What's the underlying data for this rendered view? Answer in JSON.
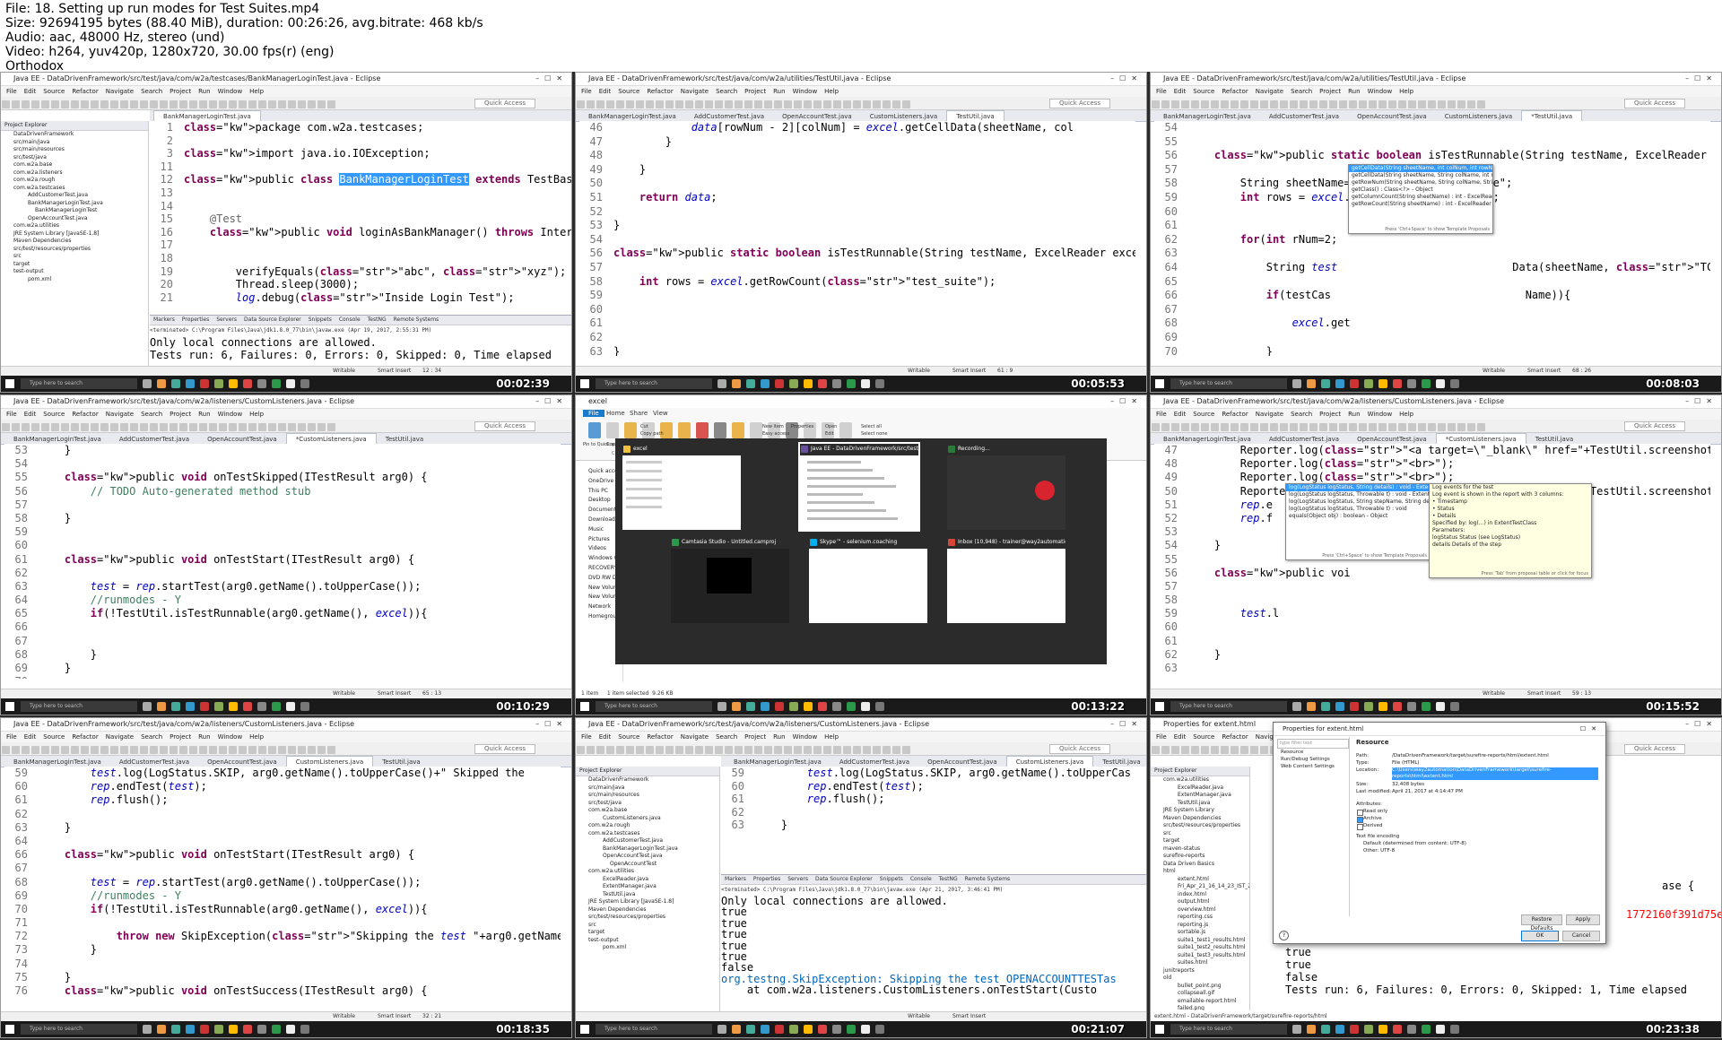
{
  "header": {
    "file": "File: 18. Setting up run modes for Test Suites.mp4",
    "size": "Size: 92694195 bytes (88.40 MiB), duration: 00:26:26, avg.bitrate: 468 kb/s",
    "audio": "Audio: aac, 48000 Hz, stereo (und)",
    "video": "Video: h264, yuv420p, 1280x720, 30.00 fps(r) (eng)",
    "watermark": "Orthodox"
  },
  "common": {
    "menu": [
      "File",
      "Edit",
      "Source",
      "Refactor",
      "Navigate",
      "Search",
      "Project",
      "Run",
      "Window",
      "Help"
    ],
    "quick_access": "Quick Access",
    "taskbar_search": "Type here to search",
    "status_writable": "Writable",
    "status_insert": "Smart Insert",
    "console_tabs": [
      "Markers",
      "Properties",
      "Servers",
      "Data Source Explorer",
      "Snippets",
      "Console",
      "TestNG",
      "Remote Systems"
    ],
    "explorer_title": "Project Explorer"
  },
  "tiles": [
    {
      "title": "Java EE - DataDrivenFramework/src/test/java/com/w2a/testcases/BankManagerLoginTest.java - Eclipse",
      "timestamp": "00:02:39",
      "tabs": [
        "BankManagerLoginTest.java"
      ],
      "explorer": [
        "DataDrivenFramework",
        "src/main/java",
        "src/main/resources",
        "src/test/java",
        "com.w2a.base",
        "com.w2a.listeners",
        "com.w2a.rough",
        "com.w2a.testcases",
        "AddCustomerTest.java",
        "BankManagerLoginTest.java",
        "BankManagerLoginTest",
        "OpenAccountTest.java",
        "com.w2a.utilities",
        "JRE System Library [JavaSE-1.8]",
        "Maven Dependencies",
        "src/test/resources/properties",
        "src",
        "target",
        "test-output",
        "pom.xml"
      ],
      "code": [
        {
          "n": "1",
          "t": "package com.w2a.testcases;"
        },
        {
          "n": "2",
          "t": ""
        },
        {
          "n": "3",
          "t": "import java.io.IOException;"
        },
        {
          "n": "11",
          "t": ""
        },
        {
          "n": "12",
          "t": "public class BankManagerLoginTest extends TestBase {"
        },
        {
          "n": "13",
          "t": ""
        },
        {
          "n": "14",
          "t": ""
        },
        {
          "n": "15",
          "t": "    @Test"
        },
        {
          "n": "16",
          "t": "    public void loginAsBankManager() throws InterruptedExc"
        },
        {
          "n": "17",
          "t": ""
        },
        {
          "n": "18",
          "t": ""
        },
        {
          "n": "19",
          "t": "        verifyEquals(\"abc\", \"xyz\");"
        },
        {
          "n": "20",
          "t": "        Thread.sleep(3000);"
        },
        {
          "n": "21",
          "t": "        log.debug(\"Inside Login Test\");"
        }
      ],
      "console_header": "<terminated> C:\\Program Files\\Java\\jdk1.8.0_77\\bin\\javaw.exe (Apr 19, 2017, 2:55:31 PM)",
      "console": [
        "Only local connections are allowed.",
        "Tests run: 6, Failures: 0, Errors: 0, Skipped: 0, Time elapsed"
      ],
      "status_pos": "12 : 34"
    },
    {
      "title": "Java EE - DataDrivenFramework/src/test/java/com/w2a/utilities/TestUtil.java - Eclipse",
      "timestamp": "00:05:53",
      "tabs": [
        "BankManagerLoginTest.java",
        "AddCustomerTest.java",
        "OpenAccountTest.java",
        "CustomListeners.java",
        "TestUtil.java"
      ],
      "code": [
        {
          "n": "46",
          "t": "            data[rowNum - 2][colNum] = excel.getCellData(sheetName, col"
        },
        {
          "n": "47",
          "t": "        }"
        },
        {
          "n": "48",
          "t": ""
        },
        {
          "n": "49",
          "t": "    }"
        },
        {
          "n": "50",
          "t": ""
        },
        {
          "n": "51",
          "t": "    return data;"
        },
        {
          "n": "52",
          "t": ""
        },
        {
          "n": "53",
          "t": "}"
        },
        {
          "n": "54",
          "t": ""
        },
        {
          "n": "56",
          "t": "public static boolean isTestRunnable(String testName, ExcelReader excel"
        },
        {
          "n": "57",
          "t": ""
        },
        {
          "n": "58",
          "t": "    int rows = excel.getRowCount(\"test_suite\");"
        },
        {
          "n": "59",
          "t": ""
        },
        {
          "n": "60",
          "t": ""
        },
        {
          "n": "61",
          "t": ""
        },
        {
          "n": "62",
          "t": ""
        },
        {
          "n": "63",
          "t": "}"
        }
      ],
      "status_pos": "61 : 9"
    },
    {
      "title": "Java EE - DataDrivenFramework/src/test/java/com/w2a/utilities/TestUtil.java - Eclipse",
      "timestamp": "00:08:03",
      "tabs": [
        "BankManagerLoginTest.java",
        "AddCustomerTest.java",
        "OpenAccountTest.java",
        "CustomListeners.java",
        "*TestUtil.java"
      ],
      "code": [
        {
          "n": "54",
          "t": ""
        },
        {
          "n": "55",
          "t": ""
        },
        {
          "n": "56",
          "t": "    public static boolean isTestRunnable(String testName, ExcelReader excel"
        },
        {
          "n": "57",
          "t": ""
        },
        {
          "n": "58",
          "t": "        String sheetName=\"test_suite\";"
        },
        {
          "n": "59",
          "t": "        int rows = excel.getRowCount(sheetName);"
        },
        {
          "n": "60",
          "t": ""
        },
        {
          "n": "61",
          "t": ""
        },
        {
          "n": "62",
          "t": "        for(int rNum=2;"
        },
        {
          "n": "63",
          "t": ""
        },
        {
          "n": "64",
          "t": "            String test                           Data(sheetName, \"TCID\", rNum);"
        },
        {
          "n": "65",
          "t": ""
        },
        {
          "n": "66",
          "t": "            if(testCas                              Name)){"
        },
        {
          "n": "67",
          "t": ""
        },
        {
          "n": "68",
          "t": "                excel.get"
        },
        {
          "n": "69",
          "t": ""
        },
        {
          "n": "70",
          "t": "            }"
        },
        {
          "n": "71",
          "t": ""
        }
      ],
      "popup": [
        "getCellData(String sheetName, int colNum, int rowNum) : St",
        "getCellData(String sheetName, String colName, int rowNum",
        "getRowNum(String sheetName, String colName, String c",
        "getClass() : Class<?> - Object",
        "getColumnCount(String sheetName) : int - ExcelReader",
        "getRowCount(String sheetName) : int - ExcelReader"
      ],
      "popup_footer": "Press 'Ctrl+Space' to show Template Proposals",
      "status_pos": "68 : 26"
    },
    {
      "title": "Java EE - DataDrivenFramework/src/test/java/com/w2a/listeners/CustomListeners.java - Eclipse",
      "timestamp": "00:10:29",
      "tabs": [
        "BankManagerLoginTest.java",
        "AddCustomerTest.java",
        "OpenAccountTest.java",
        "*CustomListeners.java",
        "TestUtil.java"
      ],
      "code": [
        {
          "n": "53",
          "t": "    }"
        },
        {
          "n": "54",
          "t": ""
        },
        {
          "n": "55",
          "t": "    public void onTestSkipped(ITestResult arg0) {"
        },
        {
          "n": "56",
          "t": "        // TODO Auto-generated method stub"
        },
        {
          "n": "57",
          "t": ""
        },
        {
          "n": "58",
          "t": "    }"
        },
        {
          "n": "59",
          "t": ""
        },
        {
          "n": "60",
          "t": ""
        },
        {
          "n": "61",
          "t": "    public void onTestStart(ITestResult arg0) {"
        },
        {
          "n": "62",
          "t": ""
        },
        {
          "n": "63",
          "t": "        test = rep.startTest(arg0.getName().toUpperCase());"
        },
        {
          "n": "64",
          "t": "        //runmodes - Y"
        },
        {
          "n": "65",
          "t": "        if(!TestUtil.isTestRunnable(arg0.getName(), excel)){"
        },
        {
          "n": "66",
          "t": ""
        },
        {
          "n": "67",
          "t": ""
        },
        {
          "n": "68",
          "t": "        }"
        },
        {
          "n": "69",
          "t": "    }"
        },
        {
          "n": "70",
          "t": ""
        }
      ],
      "status_pos": "65 : 13"
    },
    {
      "title": "excel",
      "timestamp": "00:13:22",
      "ribbon_tabs": [
        "File",
        "Home",
        "Share",
        "View"
      ],
      "ribbon_labels": [
        "Pin to Quick access",
        "Copy",
        "Paste",
        "Cut",
        "Copy path",
        "Paste shortcut",
        "Move to",
        "Copy to",
        "Delete",
        "Rename",
        "New folder",
        "New item",
        "Easy access",
        "Properties",
        "Open",
        "Edit",
        "History",
        "Select all",
        "Select none",
        "Invert selection"
      ],
      "ribbon_groups": [
        "Clipboard",
        "Organize",
        "New",
        "Open",
        "Select"
      ],
      "nav": [
        "Quick access",
        "OneDrive",
        "This PC",
        "Desktop",
        "Documents",
        "Downloads",
        "Music",
        "Pictures",
        "Videos",
        "Windows (C:)",
        "RECOVERY (D:)",
        "DVD RW Drive",
        "New Volume",
        "New Volume",
        "Network",
        "Homegroup"
      ],
      "thumbs": [
        {
          "title": "excel",
          "color": "#f0c040"
        },
        {
          "title": "Java EE - DataDrivenFramework/src/test/java/...",
          "color": "#6a4fa0"
        },
        {
          "title": "Recording...",
          "color": "#2a7a3a"
        },
        {
          "title": "Camtasia Studio - Untitled.camproj",
          "color": "#2a9a4a"
        },
        {
          "title": "Skype™ - selenium.coaching",
          "color": "#00aff0"
        },
        {
          "title": "Inbox (10,948) - trainer@way2automation.co...",
          "color": "#d44638"
        }
      ],
      "status": "1 item     1 item selected  9.26 KB"
    },
    {
      "title": "Java EE - DataDrivenFramework/src/test/java/com/w2a/listeners/CustomListeners.java - Eclipse",
      "timestamp": "00:15:52",
      "tabs": [
        "BankManagerLoginTest.java",
        "AddCustomerTest.java",
        "OpenAccountTest.java",
        "*CustomListeners.java",
        "TestUtil.java"
      ],
      "code": [
        {
          "n": "47",
          "t": "        Reporter.log(\"<a target=\\\"_blank\\\" href=\"+TestUtil.screenshotName+\""
        },
        {
          "n": "48",
          "t": "        Reporter.log(\"<br>\");"
        },
        {
          "n": "49",
          "t": "        Reporter.log(\"<br>\");"
        },
        {
          "n": "50",
          "t": "        Reporter.log(\"<a target=\\\"_blank\\\" href=\"+TestUtil.screenshotName+\""
        },
        {
          "n": "51",
          "t": "        rep.e"
        },
        {
          "n": "52",
          "t": "        rep.f"
        },
        {
          "n": "53",
          "t": ""
        },
        {
          "n": "54",
          "t": "    }"
        },
        {
          "n": "55",
          "t": ""
        },
        {
          "n": "56",
          "t": "    public voi"
        },
        {
          "n": "57",
          "t": ""
        },
        {
          "n": "58",
          "t": ""
        },
        {
          "n": "59",
          "t": "        test.l"
        },
        {
          "n": "60",
          "t": ""
        },
        {
          "n": "61",
          "t": ""
        },
        {
          "n": "62",
          "t": "    }"
        },
        {
          "n": "63",
          "t": ""
        }
      ],
      "popup": [
        "log(LogStatus logStatus, String details) : void - ExtentTest",
        "log(LogStatus logStatus, Throwable t) : void - ExtentTest",
        "log(LogStatus logStatus, String stepName, String details) : void",
        "log(LogStatus logStatus, Throwable t) : void",
        "equals(Object obj) : boolean - Object"
      ],
      "popup_footer": "Press 'Ctrl+Space' to show Template Proposals",
      "doc": [
        "Log events for the test",
        "Log event is shown in the report with 3 columns:",
        "• Timestamp",
        "• Status",
        "• Details",
        "Specified by: log(...) in ExtentTestClass",
        "Parameters:",
        "logStatus Status (see LogStatus)",
        "details Details of the step"
      ],
      "doc_footer": "Press 'Tab' from proposal table or click for focus",
      "status_pos": "59 : 13"
    },
    {
      "title": "Java EE - DataDrivenFramework/src/test/java/com/w2a/listeners/CustomListeners.java - Eclipse",
      "timestamp": "00:18:35",
      "tabs": [
        "BankManagerLoginTest.java",
        "AddCustomerTest.java",
        "OpenAccountTest.java",
        "CustomListeners.java",
        "TestUtil.java"
      ],
      "code": [
        {
          "n": "59",
          "t": "        test.log(LogStatus.SKIP, arg0.getName().toUpperCase()+\" Skipped the"
        },
        {
          "n": "60",
          "t": "        rep.endTest(test);"
        },
        {
          "n": "61",
          "t": "        rep.flush();"
        },
        {
          "n": "62",
          "t": ""
        },
        {
          "n": "63",
          "t": "    }"
        },
        {
          "n": "64",
          "t": ""
        },
        {
          "n": "66",
          "t": "    public void onTestStart(ITestResult arg0) {"
        },
        {
          "n": "67",
          "t": ""
        },
        {
          "n": "68",
          "t": "        test = rep.startTest(arg0.getName().toUpperCase());"
        },
        {
          "n": "69",
          "t": "        //runmodes - Y"
        },
        {
          "n": "70",
          "t": "        if(!TestUtil.isTestRunnable(arg0.getName(), excel)){"
        },
        {
          "n": "71",
          "t": ""
        },
        {
          "n": "72",
          "t": "            throw new SkipException(\"Skipping the test \"+arg0.getName().toU"
        },
        {
          "n": "73",
          "t": "        }"
        },
        {
          "n": "74",
          "t": ""
        },
        {
          "n": "75",
          "t": "    }"
        },
        {
          "n": "76",
          "t": "    public void onTestSuccess(ITestResult arg0) {"
        }
      ],
      "status_pos": "32 : 21"
    },
    {
      "title": "Java EE - DataDrivenFramework/src/test/java/com/w2a/listeners/CustomListeners.java - Eclipse",
      "timestamp": "00:21:07",
      "tabs": [
        "BankManagerLoginTest.java",
        "AddCustomerTest.java",
        "OpenAccountTest.java",
        "CustomListeners.java",
        "TestUtil.java"
      ],
      "explorer": [
        "DataDrivenFramework",
        "src/main/java",
        "src/main/resources",
        "src/test/java",
        "com.w2a.base",
        "CustomListeners.java",
        "com.w2a.rough",
        "com.w2a.testcases",
        "AddCustomerTest.java",
        "BankManagerLoginTest.java",
        "OpenAccountTest.java",
        "OpenAccountTest",
        "com.w2a.utilities",
        "ExcelReader.java",
        "ExtentManager.java",
        "TestUtil.java",
        "JRE System Library [JavaSE-1.8]",
        "Maven Dependencies",
        "src/test/resources/properties",
        "src",
        "target",
        "test-output",
        "pom.xml"
      ],
      "code": [
        {
          "n": "59",
          "t": "        test.log(LogStatus.SKIP, arg0.getName().toUpperCas"
        },
        {
          "n": "60",
          "t": "        rep.endTest(test);"
        },
        {
          "n": "61",
          "t": "        rep.flush();"
        },
        {
          "n": "62",
          "t": ""
        },
        {
          "n": "63",
          "t": "    }"
        }
      ],
      "console_header": "<terminated> C:\\Program Files\\Java\\jdk1.8.0_77\\bin\\javaw.exe (Apr 21, 2017, 3:46:41 PM)",
      "console": [
        "Only local connections are allowed.",
        "true",
        "true",
        "true",
        "true",
        "true",
        "false",
        "org.testng.SkipException: Skipping the test OPENACCOUNTTESTas",
        "    at com.w2a.listeners.CustomListeners.onTestStart(Custo"
      ]
    },
    {
      "title": "Properties for extent.html",
      "timestamp": "00:23:38",
      "explorer": [
        "com.w2a.utilities",
        "ExcelReader.java",
        "ExtentManager.java",
        "TestUtil.java",
        "JRE System Library",
        "Maven Dependencies",
        "src/test/resources/properties",
        "src",
        "target",
        "maven-status",
        "surefire-reports",
        "Data Driven Basics",
        "html",
        "extent.html",
        "Fri_Apr_21_16_14_23_IST_2017.jpg",
        "index.html",
        "output.html",
        "overview.html",
        "reporting.css",
        "reporting.js",
        "sortable.js",
        "suite1_test1_results.html",
        "suite1_test2_results.html",
        "suite1_test3_results.html",
        "suites.html",
        "junitreports",
        "old",
        "bullet_point.png",
        "collapseall.gif",
        "emailable-report.html",
        "failed.png",
        "index.html"
      ],
      "dialog_nav": [
        "Resource",
        "Run/Debug Settings",
        "Web Content Settings"
      ],
      "filter": "type filter text",
      "resource_title": "Resource",
      "fields": [
        {
          "k": "Path:",
          "v": "/DataDrivenFramework/target/surefire-reports/html/extent.html"
        },
        {
          "k": "Type:",
          "v": "File  (HTML)"
        },
        {
          "k": "Location:",
          "v": "C:\\Users\\way2automation\\DataDrivenFramework\\target\\surefire-reports\\html\\extent.html"
        },
        {
          "k": "Size:",
          "v": "32,408 bytes"
        },
        {
          "k": "Last modified:",
          "v": "April 21, 2017 at 4:14:47 PM"
        }
      ],
      "attributes": [
        "Attributes:",
        "Read only",
        "Archive",
        "Derived"
      ],
      "encoding": [
        "Text file encoding",
        "Default (determined from content: UTF-8)",
        "Other:  UTF-8"
      ],
      "buttons": {
        "restore": "Restore Defaults",
        "apply": "Apply",
        "ok": "OK",
        "cancel": "Cancel"
      },
      "console": [
        "true",
        "true",
        "false",
        "Tests run: 6, Failures: 0, Errors: 0, Skipped: 1, Time elapsed"
      ],
      "code_frag": [
        "ase {",
        "1772160f391d75e58"
      ],
      "bottom_status": "extent.html - DataDrivenFramework/target/surefire-reports/html"
    }
  ]
}
